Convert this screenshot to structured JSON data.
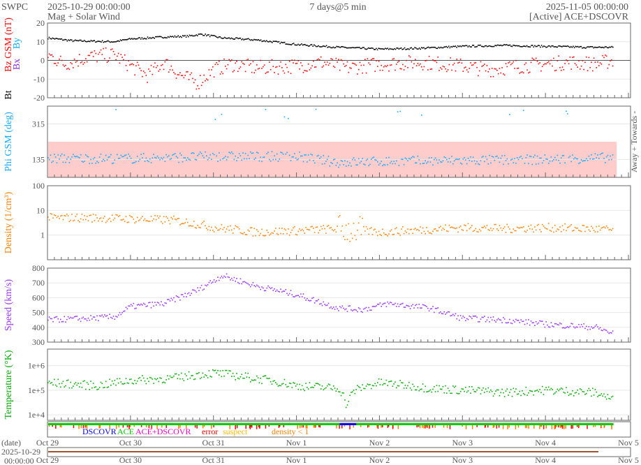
{
  "header": {
    "org": "SWPC",
    "start": "2025-10-29 00:00:00",
    "subtitle": "Mag + Solar Wind",
    "span": "7 days@5 min",
    "end": "2025-11-05 00:00:00",
    "source": "[Active] ACE+DSCOVR"
  },
  "colors": {
    "bt": "#000000",
    "bz": "#ff0000",
    "bx": "#8a2be2",
    "by": "#00aaff",
    "phi": "#11aaff",
    "away_band": "#ffcccc",
    "density": "#ff8000",
    "speed": "#9933ff",
    "temp": "#00aa00",
    "dscovr": "#0000ff",
    "ace": "#00cc00",
    "ace_dscovr": "#ff00cc",
    "error": "#ff0000",
    "suspect": "#ffbb00",
    "lowdensity": "#ff8000",
    "datebar": "#a0522d"
  },
  "chart_data": [
    {
      "type": "scatter",
      "id": "mag",
      "ylabels": [
        "Bt",
        "Bz GSM (nT)",
        "Bx",
        "By"
      ],
      "ylim": [
        -20,
        20
      ],
      "yticks": [
        "20",
        "10",
        "0",
        "-10",
        "-20"
      ],
      "ytick_values": [
        20,
        10,
        0,
        -10,
        -20
      ],
      "series": [
        {
          "name": "Bt",
          "points": [
            [
              0,
              12
            ],
            [
              0.3,
              10.5
            ],
            [
              0.8,
              10
            ],
            [
              1,
              11.5
            ],
            [
              1.4,
              12.5
            ],
            [
              1.7,
              13
            ],
            [
              1.85,
              14
            ],
            [
              2.1,
              12
            ],
            [
              2.5,
              11
            ],
            [
              3,
              8.5
            ],
            [
              3.5,
              7
            ],
            [
              4,
              6
            ],
            [
              4.5,
              6.5
            ],
            [
              5,
              7.5
            ],
            [
              5.5,
              8
            ],
            [
              6,
              7.5
            ],
            [
              6.5,
              7
            ],
            [
              6.8,
              7
            ]
          ]
        },
        {
          "name": "Bz",
          "points": [
            [
              0,
              3
            ],
            [
              0.2,
              -2
            ],
            [
              0.5,
              2
            ],
            [
              0.8,
              3
            ],
            [
              1,
              -3
            ],
            [
              1.2,
              -8
            ],
            [
              1.4,
              -1
            ],
            [
              1.6,
              -8
            ],
            [
              1.8,
              -12
            ],
            [
              2,
              -5
            ],
            [
              2.2,
              -2
            ],
            [
              2.5,
              -4
            ],
            [
              3,
              -3
            ],
            [
              3.3,
              -1
            ],
            [
              3.6,
              -4
            ],
            [
              4,
              -2
            ],
            [
              4.5,
              -1
            ],
            [
              5,
              -3
            ],
            [
              5.3,
              -5
            ],
            [
              5.7,
              -3
            ],
            [
              6,
              -2
            ],
            [
              6.3,
              -1
            ],
            [
              6.6,
              -2
            ],
            [
              6.8,
              0
            ]
          ]
        }
      ]
    },
    {
      "type": "scatter",
      "id": "phi",
      "ylabel": "Phi GSM (deg)",
      "right_label": "Away + Towards -",
      "ylim": [
        45,
        405
      ],
      "band": [
        45,
        225
      ],
      "yticks": [
        "315",
        "135"
      ],
      "ytick_values": [
        315,
        135
      ],
      "series": [
        {
          "name": "Phi",
          "points": [
            [
              0,
              140
            ],
            [
              1,
              140
            ],
            [
              2,
              150
            ],
            [
              3,
              150
            ],
            [
              3.5,
              120
            ],
            [
              4,
              125
            ],
            [
              5,
              130
            ],
            [
              6,
              135
            ],
            [
              6.8,
              145
            ]
          ]
        }
      ]
    },
    {
      "type": "scatter",
      "id": "density",
      "ylabel": "Density (1/cm³)",
      "scale": "log",
      "ylim": [
        0.1,
        100
      ],
      "yticks": [
        "100",
        "10",
        "1"
      ],
      "ytick_values": [
        100,
        10,
        1
      ],
      "series": [
        {
          "name": "Density",
          "points": [
            [
              0,
              5
            ],
            [
              0.5,
              5
            ],
            [
              1,
              4.5
            ],
            [
              1.5,
              4
            ],
            [
              2,
              2
            ],
            [
              2.5,
              1.3
            ],
            [
              3,
              1.5
            ],
            [
              3.5,
              1.8
            ],
            [
              4,
              1.3
            ],
            [
              4.5,
              1.6
            ],
            [
              5,
              2
            ],
            [
              5.5,
              1.8
            ],
            [
              6,
              2
            ],
            [
              6.5,
              1.8
            ],
            [
              6.8,
              1.6
            ]
          ]
        }
      ]
    },
    {
      "type": "scatter",
      "id": "speed",
      "ylabel": "Speed (km/s)",
      "ylim": [
        300,
        800
      ],
      "yticks": [
        "800",
        "700",
        "600",
        "500",
        "400",
        "300"
      ],
      "ytick_values": [
        800,
        700,
        600,
        500,
        400,
        300
      ],
      "series": [
        {
          "name": "Speed",
          "points": [
            [
              0,
              450
            ],
            [
              0.5,
              460
            ],
            [
              0.8,
              470
            ],
            [
              1,
              540
            ],
            [
              1.4,
              560
            ],
            [
              1.8,
              650
            ],
            [
              2.1,
              750
            ],
            [
              2.5,
              680
            ],
            [
              3,
              620
            ],
            [
              3.5,
              530
            ],
            [
              3.8,
              520
            ],
            [
              4.1,
              560
            ],
            [
              4.6,
              530
            ],
            [
              5,
              460
            ],
            [
              5.5,
              450
            ],
            [
              6,
              420
            ],
            [
              6.6,
              400
            ],
            [
              6.8,
              360
            ]
          ]
        }
      ]
    },
    {
      "type": "scatter",
      "id": "temperature",
      "ylabel": "Temperature (°K)",
      "scale": "log",
      "ylim": [
        6000,
        4700000
      ],
      "yticks": [
        "1e+6",
        "1e+5",
        "1e+4"
      ],
      "ytick_values": [
        1000000,
        100000,
        10000
      ],
      "series": [
        {
          "name": "Temperature",
          "points": [
            [
              0,
              200000
            ],
            [
              0.6,
              150000
            ],
            [
              1,
              250000
            ],
            [
              1.5,
              300000
            ],
            [
              2,
              500000
            ],
            [
              2.5,
              300000
            ],
            [
              3,
              150000
            ],
            [
              3.5,
              120000
            ],
            [
              3.6,
              20000
            ],
            [
              3.7,
              100000
            ],
            [
              4,
              200000
            ],
            [
              4.6,
              120000
            ],
            [
              5,
              100000
            ],
            [
              5.5,
              80000
            ],
            [
              6,
              100000
            ],
            [
              6.6,
              80000
            ],
            [
              6.8,
              40000
            ]
          ]
        }
      ]
    }
  ],
  "status": {
    "legend": [
      "DSCOVR",
      "ACE",
      "ACE+DSCOVR",
      "error",
      "suspect",
      "density < 1"
    ],
    "dscovr_days": [
      3.52,
      3.72
    ]
  },
  "xaxis": {
    "ticks": [
      "Oct 29",
      "Oct 30",
      "Oct 31",
      "Nov 1",
      "Nov 2",
      "Nov 3",
      "Nov 4",
      "Nov 5"
    ],
    "date_label": "(date)",
    "date_start": "2025-10-29",
    "time_start": "00:00:00"
  }
}
